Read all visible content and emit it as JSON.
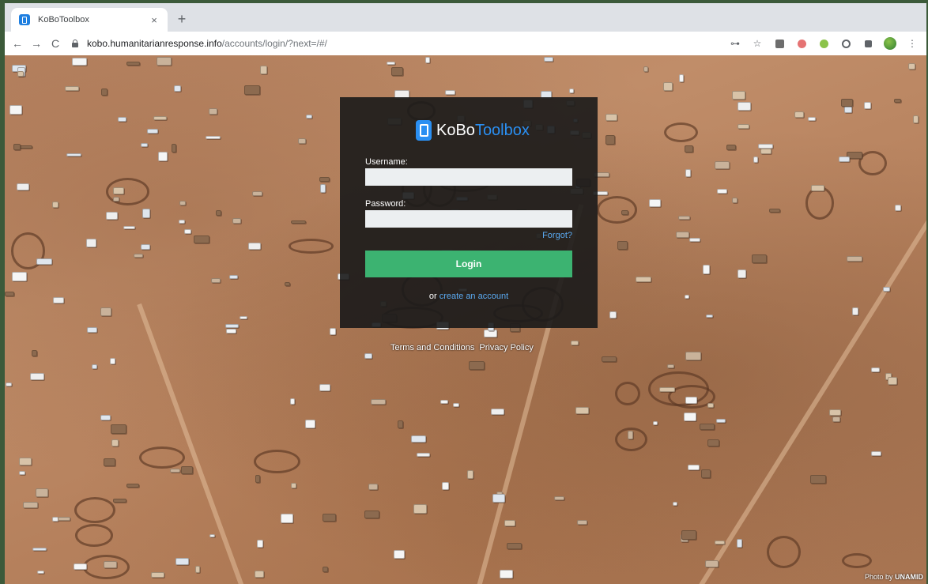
{
  "browser": {
    "tab_title": "KoBoToolbox",
    "tab_close": "×",
    "new_tab": "+",
    "url_domain": "kobo.humanitarianresponse.info",
    "url_path": "/accounts/login/?next=/#/",
    "back_glyph": "←",
    "forward_glyph": "→",
    "reload_glyph": "C",
    "menu_glyph": "⋮",
    "key_glyph": "⊶",
    "star_glyph": "☆"
  },
  "login": {
    "logo_kobo": "KoBo",
    "logo_toolbox": "Toolbox",
    "username_label": "Username:",
    "username_value": "",
    "password_label": "Password:",
    "password_value": "",
    "forgot_label": "Forgot?",
    "login_button": "Login",
    "or_text": "or ",
    "create_account_link": "create an account"
  },
  "footer": {
    "terms_label": "Terms and Conditions",
    "privacy_label": "Privacy Policy"
  },
  "photo_credit": {
    "prefix": "Photo by ",
    "credit": "UNAMID"
  },
  "icons": {
    "favicon": "kobotoolbox-favicon-icon",
    "lock": "lock-icon",
    "key": "key-icon",
    "star": "star-icon",
    "extensions": [
      "extension-1-icon",
      "extension-2-icon",
      "extension-3-icon",
      "extension-4-icon",
      "puzzle-icon"
    ],
    "menu": "kebab-menu-icon"
  },
  "colors": {
    "brand_blue": "#2a8ff2",
    "login_green": "#3cb371",
    "link_blue": "#5aa9f0"
  }
}
